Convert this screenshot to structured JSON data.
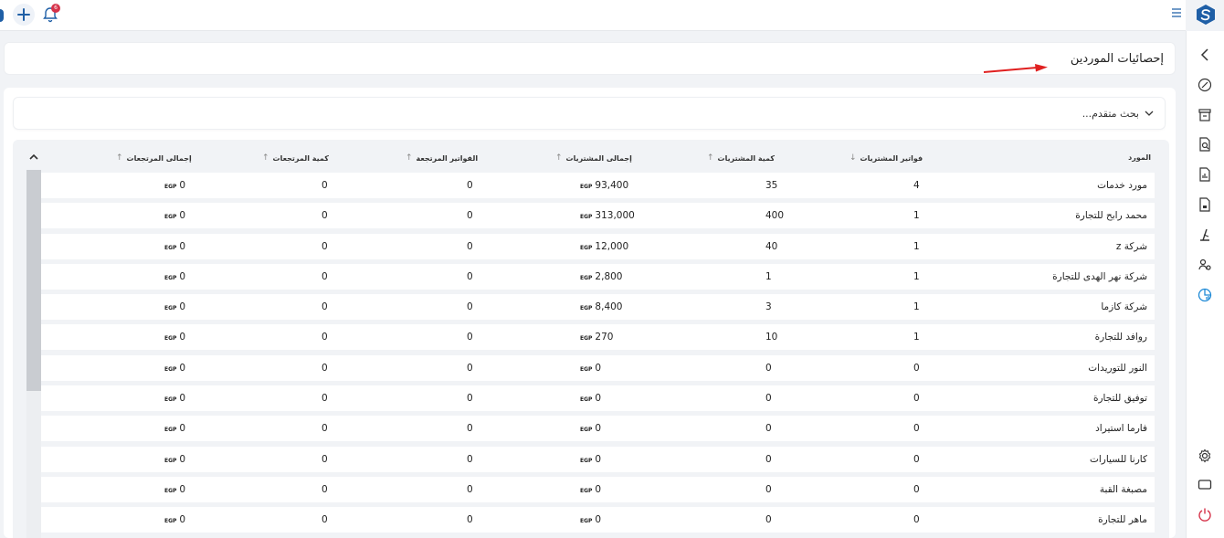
{
  "header": {
    "notifications_count": "6"
  },
  "page": {
    "title": "إحصائيات الموردين",
    "advanced_search": "بحث متقدم..."
  },
  "colors": {
    "brand": "#1f5fa6",
    "annotation_arrow": "#e02020",
    "badge": "#d6334a"
  },
  "table": {
    "currency": "EGP",
    "headers": {
      "supplier": "المورد",
      "purchase_invoices": "فواتير المشتريات",
      "purchase_qty": "كمية المشتريات",
      "purchase_total": "إجمالى المشتريات",
      "returned_invoices": "الفواتير المرتجعة",
      "returned_qty": "كمية المرتجعات",
      "returned_total": "إجمالى المرتجعات"
    },
    "rows": [
      {
        "supplier": "مورد خدمات",
        "invoices": "4",
        "qty": "35",
        "total": "93,400",
        "ret_inv": "0",
        "ret_qty": "0",
        "ret_total": "0"
      },
      {
        "supplier": "محمد رابح للتجارة",
        "invoices": "1",
        "qty": "400",
        "total": "313,000",
        "ret_inv": "0",
        "ret_qty": "0",
        "ret_total": "0"
      },
      {
        "supplier": "شركة z",
        "invoices": "1",
        "qty": "40",
        "total": "12,000",
        "ret_inv": "0",
        "ret_qty": "0",
        "ret_total": "0"
      },
      {
        "supplier": "شركة  نهر الهدى للتجارة",
        "invoices": "1",
        "qty": "1",
        "total": "2,800",
        "ret_inv": "0",
        "ret_qty": "0",
        "ret_total": "0"
      },
      {
        "supplier": "شركة كازما",
        "invoices": "1",
        "qty": "3",
        "total": "8,400",
        "ret_inv": "0",
        "ret_qty": "0",
        "ret_total": "0"
      },
      {
        "supplier": "روافد للتجارة",
        "invoices": "1",
        "qty": "10",
        "total": "270",
        "ret_inv": "0",
        "ret_qty": "0",
        "ret_total": "0"
      },
      {
        "supplier": "النور للتوريدات",
        "invoices": "0",
        "qty": "0",
        "total": "0",
        "ret_inv": "0",
        "ret_qty": "0",
        "ret_total": "0"
      },
      {
        "supplier": "توفيق للتجارة",
        "invoices": "0",
        "qty": "0",
        "total": "0",
        "ret_inv": "0",
        "ret_qty": "0",
        "ret_total": "0"
      },
      {
        "supplier": "فارما استيراد",
        "invoices": "0",
        "qty": "0",
        "total": "0",
        "ret_inv": "0",
        "ret_qty": "0",
        "ret_total": "0"
      },
      {
        "supplier": "كارنا للسيارات",
        "invoices": "0",
        "qty": "0",
        "total": "0",
        "ret_inv": "0",
        "ret_qty": "0",
        "ret_total": "0"
      },
      {
        "supplier": "مصبغة القبة",
        "invoices": "0",
        "qty": "0",
        "total": "0",
        "ret_inv": "0",
        "ret_qty": "0",
        "ret_total": "0"
      },
      {
        "supplier": "ماهر للتجارة",
        "invoices": "0",
        "qty": "0",
        "total": "0",
        "ret_inv": "0",
        "ret_qty": "0",
        "ret_total": "0"
      }
    ]
  }
}
